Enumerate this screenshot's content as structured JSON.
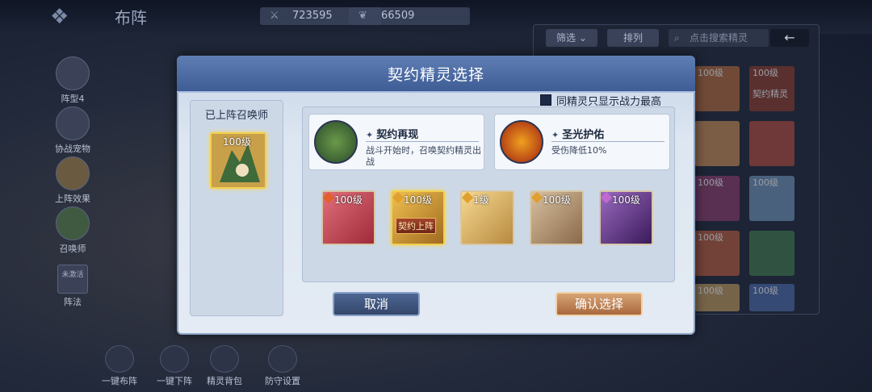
{
  "topbar": {
    "title": "布阵",
    "power_value": "723595",
    "second_value": "66509"
  },
  "left_nav": [
    {
      "label": "阵型4"
    },
    {
      "label": "协战宠物"
    },
    {
      "label": "上阵效果"
    },
    {
      "label": "召唤师"
    },
    {
      "label": "阵法",
      "badge": "未激活"
    }
  ],
  "bottom_nav": [
    {
      "label": "一键布阵"
    },
    {
      "label": "一键下阵"
    },
    {
      "label": "精灵背包"
    },
    {
      "label": "防守设置"
    }
  ],
  "right_panel": {
    "filter_label": "筛选",
    "sort_label": "排列",
    "search_placeholder": "点击搜索精灵",
    "back_icon": "←",
    "cards": [
      {
        "level": "100级",
        "name": "",
        "color": "#b46a3a"
      },
      {
        "level": "100级",
        "name": "契约精灵",
        "color": "#8c3a2a"
      },
      {
        "level": "",
        "name": "",
        "color": "#c88a52"
      },
      {
        "level": "",
        "name": "",
        "color": "#b04a3a"
      },
      {
        "level": "100级",
        "name": "",
        "color": "#8a3a6a"
      },
      {
        "level": "100级",
        "name": "",
        "color": "#6f94b8"
      },
      {
        "level": "100级",
        "name": "",
        "color": "#b85a3a"
      },
      {
        "level": "",
        "name": "",
        "color": "#3f7a4a"
      },
      {
        "level": "100级",
        "name": "",
        "color": "#c09a5a"
      },
      {
        "level": "100级",
        "name": "",
        "color": "#4a6aa8"
      }
    ]
  },
  "dialog": {
    "title": "契约精灵选择",
    "summoned_label": "已上阵召唤师",
    "summoned_level": "100级",
    "only_show_label": "同精灵只显示战力最高",
    "skills": [
      {
        "name": "契约再现",
        "desc": "战斗开始时，召唤契约精灵出战",
        "icon": "dragon-icon"
      },
      {
        "name": "圣光护佑",
        "desc": "受伤降低10%",
        "icon": "shield-icon"
      }
    ],
    "spirits": [
      {
        "level": "100级",
        "color": "#c8404a",
        "elem": "#e0602a"
      },
      {
        "level": "100级",
        "color": "#d69a30",
        "elem": "#e0a030",
        "selected": true,
        "tag": "契约上阵"
      },
      {
        "level": "1级",
        "color": "#e0b060",
        "elem": "#e0a030"
      },
      {
        "level": "100级",
        "color": "#b89a70",
        "elem": "#e0a030"
      },
      {
        "level": "100级",
        "color": "#6a3a8a",
        "elem": "#c06ad0"
      }
    ],
    "cancel_label": "取消",
    "confirm_label": "确认选择"
  },
  "colors": {
    "dialog_header": "#4a6aa4",
    "confirm": "#c08052",
    "cancel": "#3e5480",
    "highlight": "#f3d04c"
  }
}
